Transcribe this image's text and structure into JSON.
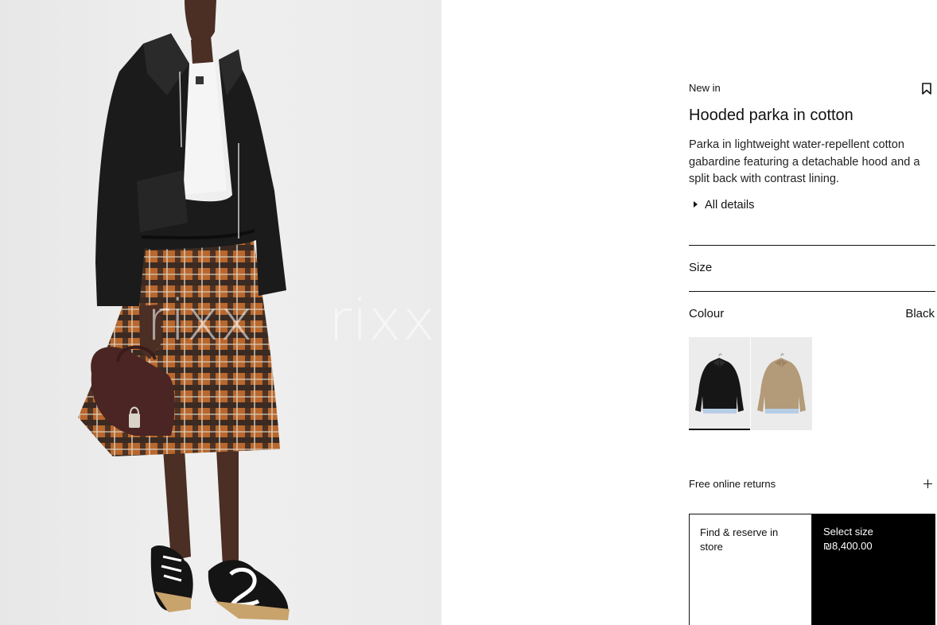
{
  "product_image": {
    "alt": "Model wearing a black hooded parka in cotton, white tee, plaid pleated skirt, brown bag and black sneakers",
    "watermarks": [
      "rixx",
      "rixx"
    ]
  },
  "product": {
    "badge": "New in",
    "title": "Hooded parka in cotton",
    "description": "Parka in lightweight water-repellent cotton gabardine featuring a detachable hood and a split back with contrast lining.",
    "details_label": "All details"
  },
  "size": {
    "label": "Size"
  },
  "colour": {
    "label": "Colour",
    "selected": "Black",
    "swatches": [
      {
        "name": "Black",
        "color": "#141414",
        "selected": true
      },
      {
        "name": "Beige",
        "color": "#b39a78",
        "selected": false
      }
    ]
  },
  "returns": {
    "label": "Free online returns"
  },
  "actions": {
    "store_label": "Find & reserve in store",
    "buy_label": "Select size",
    "price": "₪8,400.00"
  },
  "icons": {
    "bookmark": "bookmark-icon",
    "expand": "plus-icon",
    "details": "triangle-right-icon"
  }
}
